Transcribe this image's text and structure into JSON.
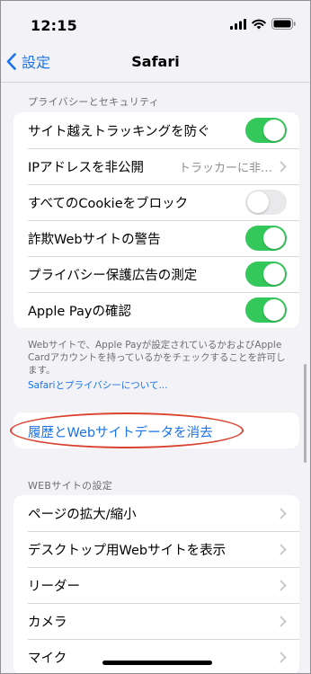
{
  "status_bar": {
    "time": "12:15"
  },
  "nav": {
    "back_label": "設定",
    "title": "Safari"
  },
  "privacy": {
    "header": "プライバシーとセキュリティ",
    "rows": [
      {
        "label": "サイト越えトラッキングを防ぐ",
        "control": "toggle",
        "on": true
      },
      {
        "label": "IPアドレスを非公開",
        "control": "value",
        "value": "トラッカーに非…"
      },
      {
        "label": "すべてのCookieをブロック",
        "control": "toggle",
        "on": false
      },
      {
        "label": "詐欺Webサイトの警告",
        "control": "toggle",
        "on": true
      },
      {
        "label": "プライバシー保護広告の測定",
        "control": "toggle",
        "on": true
      },
      {
        "label": "Apple Payの確認",
        "control": "toggle",
        "on": true
      }
    ],
    "footer": "Webサイトで、Apple Payが設定されているかおよびApple Cardアカウントを持っているかをチェックすることを許可します。",
    "footer_link": "Safariとプライバシーについて..."
  },
  "clear_history": {
    "label": "履歴とWebサイトデータを消去"
  },
  "website_settings": {
    "header": "WEBサイトの設定",
    "rows": [
      {
        "label": "ページの拡大/縮小"
      },
      {
        "label": "デスクトップ用Webサイトを表示"
      },
      {
        "label": "リーダー"
      },
      {
        "label": "カメラ"
      },
      {
        "label": "マイク"
      }
    ]
  },
  "colors": {
    "accent": "#1a73e8",
    "toggle_on": "#34c759",
    "annotation": "#d9432f"
  }
}
